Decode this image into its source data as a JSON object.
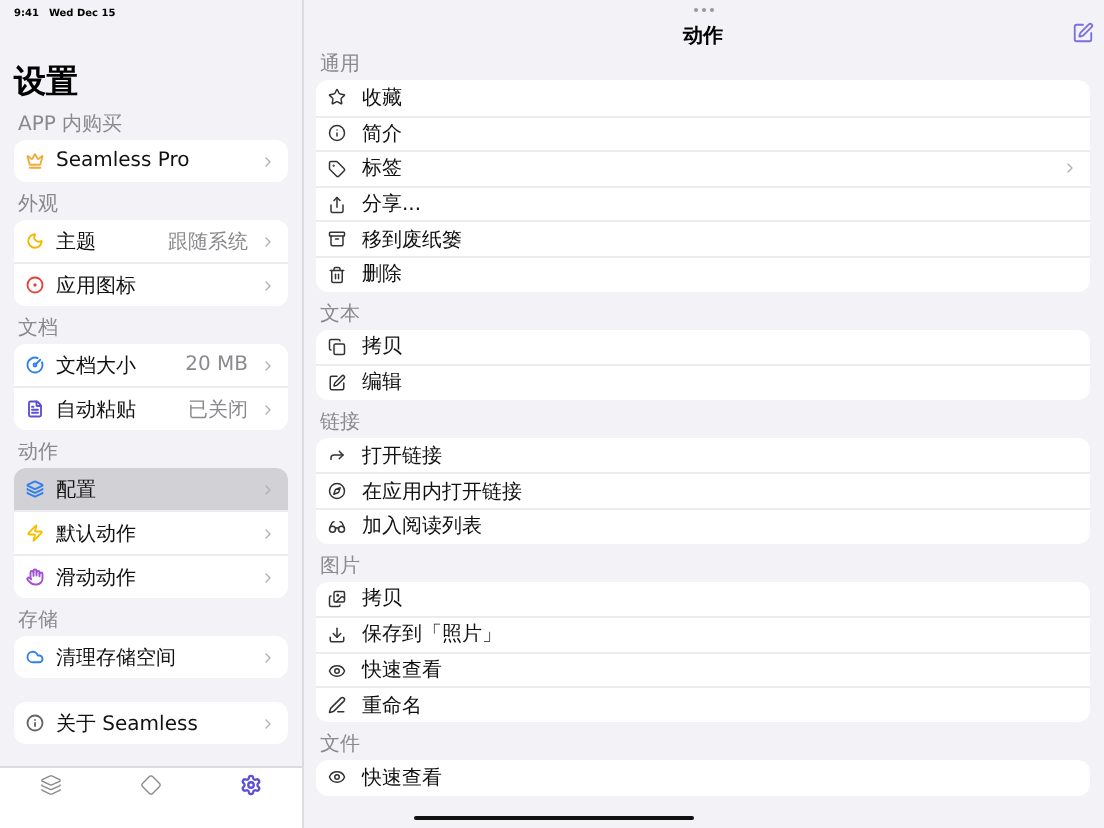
{
  "status_bar": {
    "time": "9:41",
    "date": "Wed Dec 15"
  },
  "sidebar": {
    "title": "设置",
    "sections": [
      {
        "header": "APP 内购买",
        "items": [
          {
            "label": "Seamless Pro",
            "selected": false
          }
        ]
      },
      {
        "header": "外观",
        "items": [
          {
            "label": "主题",
            "value": "跟随系统",
            "selected": false
          },
          {
            "label": "应用图标",
            "selected": false
          }
        ]
      },
      {
        "header": "文档",
        "items": [
          {
            "label": "文档大小",
            "value": "20 MB",
            "selected": false
          },
          {
            "label": "自动粘贴",
            "value": "已关闭",
            "selected": false
          }
        ]
      },
      {
        "header": "动作",
        "items": [
          {
            "label": "配置",
            "selected": true
          },
          {
            "label": "默认动作",
            "selected": false
          },
          {
            "label": "滑动动作",
            "selected": false
          }
        ]
      },
      {
        "header": "存储",
        "items": [
          {
            "label": "清理存储空间",
            "selected": false
          }
        ]
      },
      {
        "items": [
          {
            "label": "关于 Seamless",
            "selected": false
          }
        ]
      }
    ]
  },
  "tab_bar": [
    {
      "selected": false
    },
    {
      "selected": false
    },
    {
      "selected": true
    }
  ],
  "detail": {
    "title": "动作",
    "sections": [
      {
        "header": "通用",
        "items": [
          {
            "label": "收藏",
            "submenu": false
          },
          {
            "label": "简介",
            "submenu": false
          },
          {
            "label": "标签",
            "submenu": true
          },
          {
            "label": "分享...",
            "submenu": false
          },
          {
            "label": "移到废纸篓",
            "submenu": false
          },
          {
            "label": "删除",
            "submenu": false
          }
        ]
      },
      {
        "header": "文本",
        "items": [
          {
            "label": "拷贝",
            "submenu": false
          },
          {
            "label": "编辑",
            "submenu": false
          }
        ]
      },
      {
        "header": "链接",
        "items": [
          {
            "label": "打开链接",
            "submenu": false
          },
          {
            "label": "在应用内打开链接",
            "submenu": false
          },
          {
            "label": "加入阅读列表",
            "submenu": false
          }
        ]
      },
      {
        "header": "图片",
        "items": [
          {
            "label": "拷贝",
            "submenu": false
          },
          {
            "label": "保存到「照片」",
            "submenu": false
          },
          {
            "label": "快速查看",
            "submenu": false
          },
          {
            "label": "重命名",
            "submenu": false
          }
        ]
      },
      {
        "header": "文件",
        "items": [
          {
            "label": "快速查看",
            "submenu": false
          }
        ]
      }
    ]
  }
}
